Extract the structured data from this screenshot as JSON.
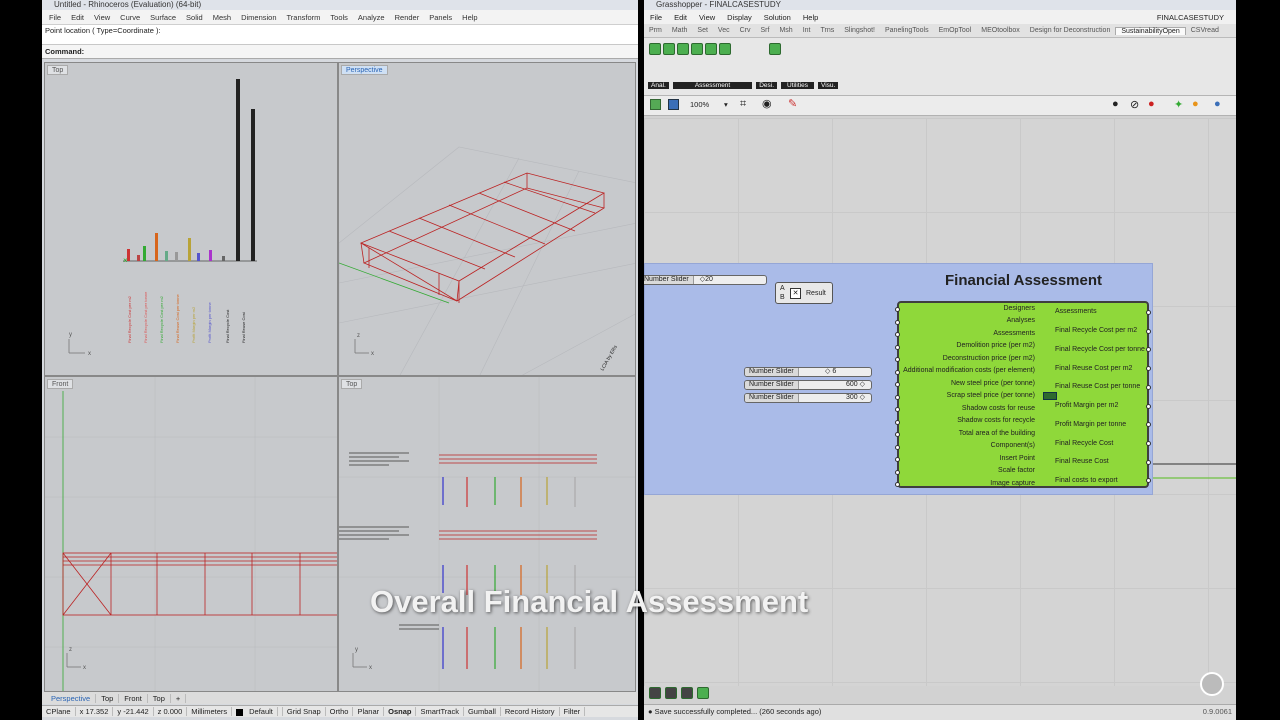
{
  "rhino": {
    "title": "Untitled - Rhinoceros (Evaluation) (64-bit)",
    "menu": [
      "File",
      "Edit",
      "View",
      "Curve",
      "Surface",
      "Solid",
      "Mesh",
      "Dimension",
      "Transform",
      "Tools",
      "Analyze",
      "Render",
      "Panels",
      "Help"
    ],
    "prompt": "Point location ( Type=Coordinate ):",
    "command_label": "Command:",
    "viewports": {
      "top": "Top",
      "perspective": "Perspective",
      "front": "Front",
      "top2": "Top"
    },
    "chart_labels": [
      "Final Recycle Cost per m2",
      "Final Recycle Cost per tonne",
      "Final Recycle Cost per m2",
      "Final Reuse Cost per tonne",
      "Profit Margin per m2",
      "Profit Margin per tonne",
      "Final Recycle Cost",
      "Final Reuse Cost"
    ],
    "view_tabs": [
      "Perspective",
      "Top",
      "Front",
      "Top",
      "+"
    ],
    "status": {
      "cplane": "CPlane",
      "x": "x 17.352",
      "y": "y -21.442",
      "z": "z 0.000",
      "units": "Millimeters",
      "layer": "Default",
      "toggles": [
        "Grid Snap",
        "Ortho",
        "Planar",
        "Osnap",
        "SmartTrack",
        "Gumball",
        "Record History",
        "Filter"
      ]
    }
  },
  "grasshopper": {
    "title": "Grasshopper - FINALCASESTUDY",
    "doc_name": "FINALCASESTUDY",
    "menu": [
      "File",
      "Edit",
      "View",
      "Display",
      "Solution",
      "Help"
    ],
    "tabs": [
      "Prm",
      "Math",
      "Set",
      "Vec",
      "Crv",
      "Srf",
      "Msh",
      "Int",
      "Trns",
      "Slingshot!",
      "PanelingTools",
      "EmOpTool",
      "MEOtoolbox",
      "Design for Deconstruction",
      "SustainabilityOpen",
      "CSVread"
    ],
    "active_tab": "SustainabilityOpen",
    "ribbon_groups": [
      "Anal.",
      "Assessment",
      "Desi.",
      "Utilities",
      "Visu."
    ],
    "zoom": "100%",
    "group_title": "Financial Assessment",
    "top_slider": {
      "label": "Number Slider",
      "value": "20"
    },
    "result_label": "Result",
    "sliders": [
      {
        "label": "Number Slider",
        "value": "6"
      },
      {
        "label": "Number Slider",
        "value": "600"
      },
      {
        "label": "Number Slider",
        "value": "300"
      }
    ],
    "inputs": [
      "Designers",
      "Analyses",
      "Assessments",
      "Demolition price (per m2)",
      "Deconstruction price (per m2)",
      "Additional modification costs (per element)",
      "New steel price (per tonne)",
      "Scrap steel price (per tonne)",
      "Shadow costs for reuse",
      "Shadow costs for recycle",
      "Total area of the building",
      "Component(s)",
      "Insert Point",
      "Scale factor",
      "Image capture"
    ],
    "outputs": [
      "Assessments",
      "Final Recycle Cost per m2",
      "Final Recycle Cost per tonne",
      "Final Reuse Cost per m2",
      "Final Reuse Cost per tonne",
      "Profit Margin per m2",
      "Profit Margin per tonne",
      "Final Recycle Cost",
      "Final Reuse Cost",
      "Final costs to export"
    ],
    "status": "Save successfully completed... (260 seconds ago)",
    "version": "0.9.0061"
  },
  "overlay_caption": "Overall Financial Assessment"
}
